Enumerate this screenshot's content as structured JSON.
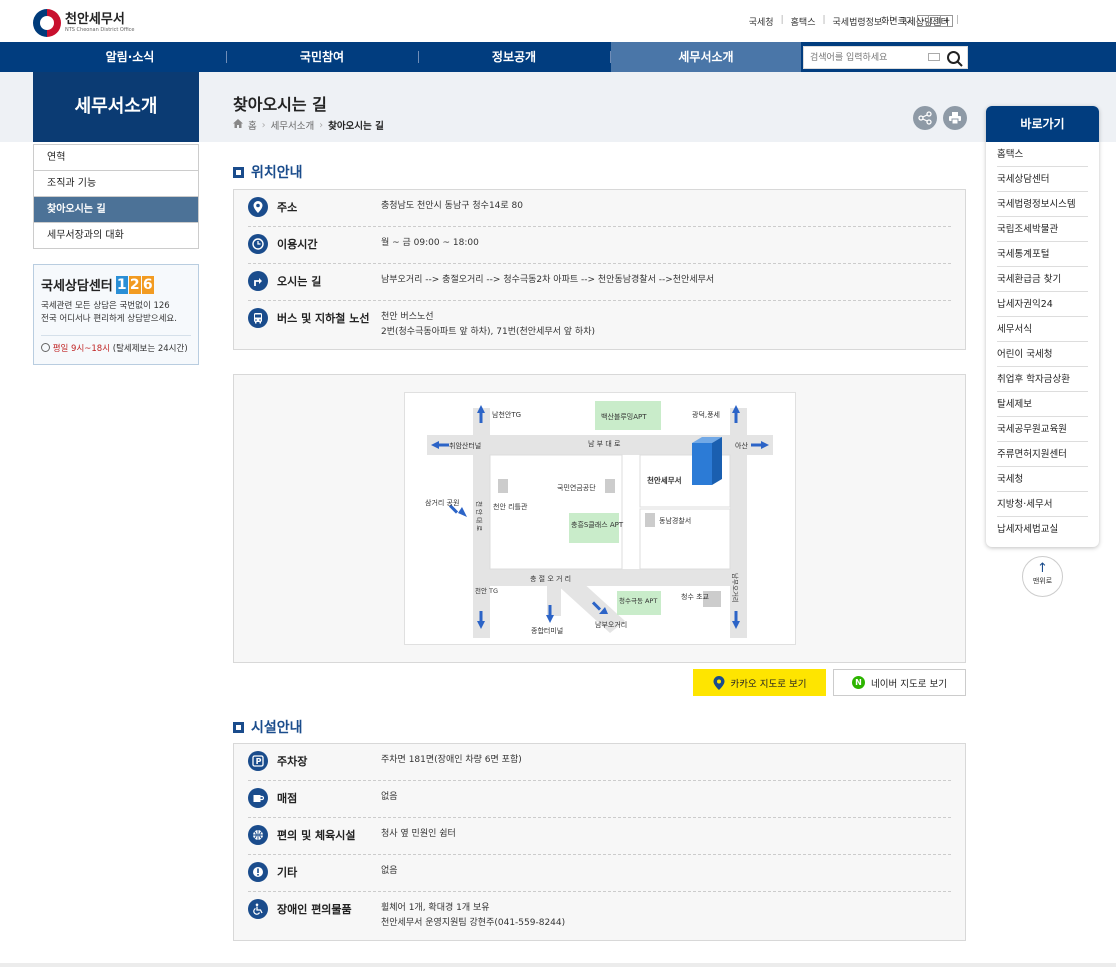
{
  "header": {
    "logo_name": "천안세무서",
    "logo_sub": "NTS Cheonan District Office",
    "utility": [
      "국세청",
      "홈택스",
      "국세법령정보",
      "국세상담센터"
    ],
    "font_size_label": "화면크기",
    "font_btns": [
      "-",
      "□",
      "+"
    ]
  },
  "gnb": {
    "items": [
      "알림·소식",
      "국민참여",
      "정보공개",
      "세무서소개"
    ],
    "active": "세무서소개",
    "search_placeholder": "검색어를 입력하세요"
  },
  "lnb": {
    "title": "세무서소개",
    "items": [
      "연혁",
      "조직과 기능",
      "찾아오시는 길",
      "세무서장과의 대화"
    ],
    "active_index": 2
  },
  "center126": {
    "title": "국세상담센터",
    "number": [
      "1",
      "2",
      "6"
    ],
    "desc_line1": "국세관련 모든 상담은 국번없이 126",
    "desc_line2": "전국 어디서나 편리하게 상담받으세요.",
    "hours_red": "평일 9시~18시",
    "hours_rest": "(탈세제보는 24시간)"
  },
  "page": {
    "title": "찾아오시는 길",
    "breadcrumb": [
      "홈",
      "세무서소개",
      "찾아오시는 길"
    ]
  },
  "location": {
    "section_title": "위치안내",
    "rows": [
      {
        "icon": "pin-icon",
        "label": "주소",
        "lines": [
          "충청남도 천안시 동남구 청수14로 80"
        ]
      },
      {
        "icon": "clock-icon",
        "label": "이용시간",
        "lines": [
          "월 ~ 금 09:00 ~ 18:00"
        ]
      },
      {
        "icon": "directions-icon",
        "label": "오시는 길",
        "lines": [
          "남부오거리 --> 충절오거리 --> 청수극동2차 아파트 --> 천안동남경찰서 -->천안세무서"
        ]
      },
      {
        "icon": "bus-icon",
        "label": "버스 및 지하철 노선",
        "lines": [
          "천안 버스노선",
          "2번(청수극동아파트 앞 하차), 71번(천안세무서 앞 하차)"
        ]
      }
    ]
  },
  "map": {
    "labels": {
      "namcheonan_tg": "남천안TG",
      "baeksan": "백산블루밍APT",
      "gwangdeok": "광덕,풍세",
      "chuiam": "취암산터널",
      "nambu_road": "남 부 대 로",
      "asan": "아산",
      "nps": "국민연금공단",
      "office": "천안세무서",
      "samgeori": "삼거리 공원",
      "cheonan_dae": "천 안 대 로",
      "library": "천안 리틀관",
      "chungheung": "충흥S클래스 APT",
      "police": "동남경찰서",
      "chungjeol": "충 절 오 거 리",
      "cheonan_tg": "천안 TG",
      "cheongsu_apt": "청수극동 APT",
      "cheongsu_school": "청수 초교",
      "nambu_5": "남부오거리",
      "terminal": "종합터미널",
      "nambu_5_bottom": "남부오거리"
    },
    "kakao_btn": "카카오 지도로 보기",
    "naver_btn": "네이버 지도로 보기"
  },
  "facility": {
    "section_title": "시설안내",
    "rows": [
      {
        "icon": "parking-icon",
        "label": "주차장",
        "lines": [
          "주차면 181면(장애인 차량 6면 포함)"
        ]
      },
      {
        "icon": "shop-icon",
        "label": "매점",
        "lines": [
          "없음"
        ]
      },
      {
        "icon": "sports-icon",
        "label": "편의 및 체육시설",
        "lines": [
          "청사 옆 민원인 쉼터"
        ]
      },
      {
        "icon": "info-icon",
        "label": "기타",
        "lines": [
          "없음"
        ]
      },
      {
        "icon": "wheelchair-icon",
        "label": "장애인 편의물품",
        "lines": [
          "휠체어 1개, 확대경 1개 보유",
          "천안세무서 운영지원팀 강현주(041-559-8244)"
        ]
      }
    ]
  },
  "quick": {
    "title": "바로가기",
    "items": [
      "홈택스",
      "국세상담센터",
      "국세법령정보시스템",
      "국립조세박물관",
      "국세통계포털",
      "국세환급금 찾기",
      "납세자권익24",
      "세무서식",
      "어린이 국세청",
      "취업후 학자금상환",
      "탈세제보",
      "국세공무원교육원",
      "주류면허지원센터",
      "국세청",
      "지방청·세무서",
      "납세자세법교실"
    ],
    "top_label": "맨위로"
  },
  "colors": {
    "brand": "#013d7f",
    "section_blue": "#1a4c8c",
    "kakao_yellow": "#fee500",
    "map_road": "#e4e4e4",
    "map_green": "#c9ecca"
  }
}
